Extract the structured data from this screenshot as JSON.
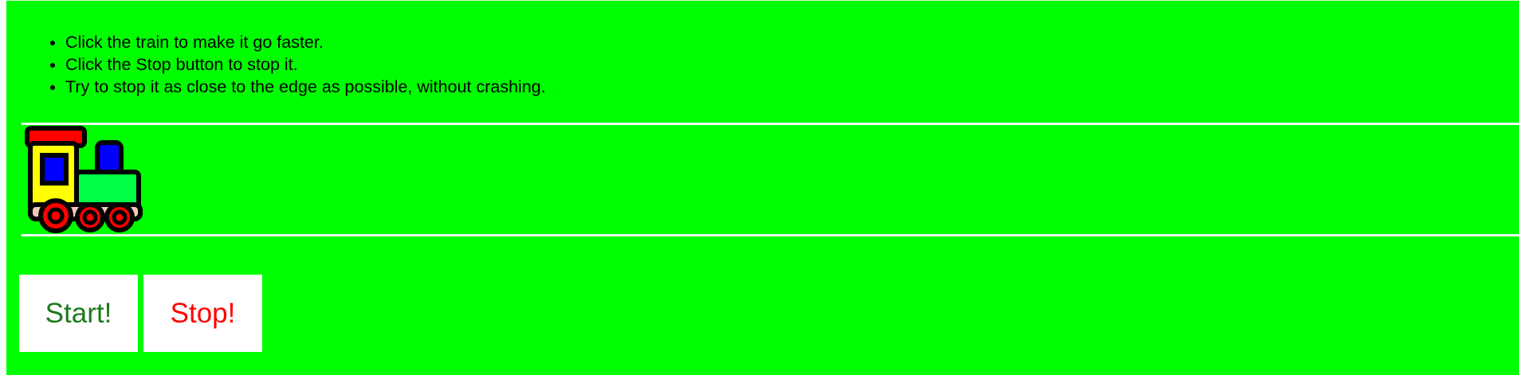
{
  "instructions": [
    "Click the train to make it go faster.",
    "Click the Stop button to stop it.",
    "Try to stop it as close to the edge as possible, without crashing."
  ],
  "train": {
    "icon": "train-icon"
  },
  "buttons": {
    "start_label": "Start!",
    "stop_label": "Stop!"
  },
  "colors": {
    "background": "#00ff00",
    "rule": "#ffffff",
    "start_text": "#1e7a1e",
    "stop_text": "#ff0000",
    "button_bg": "#ffffff"
  }
}
